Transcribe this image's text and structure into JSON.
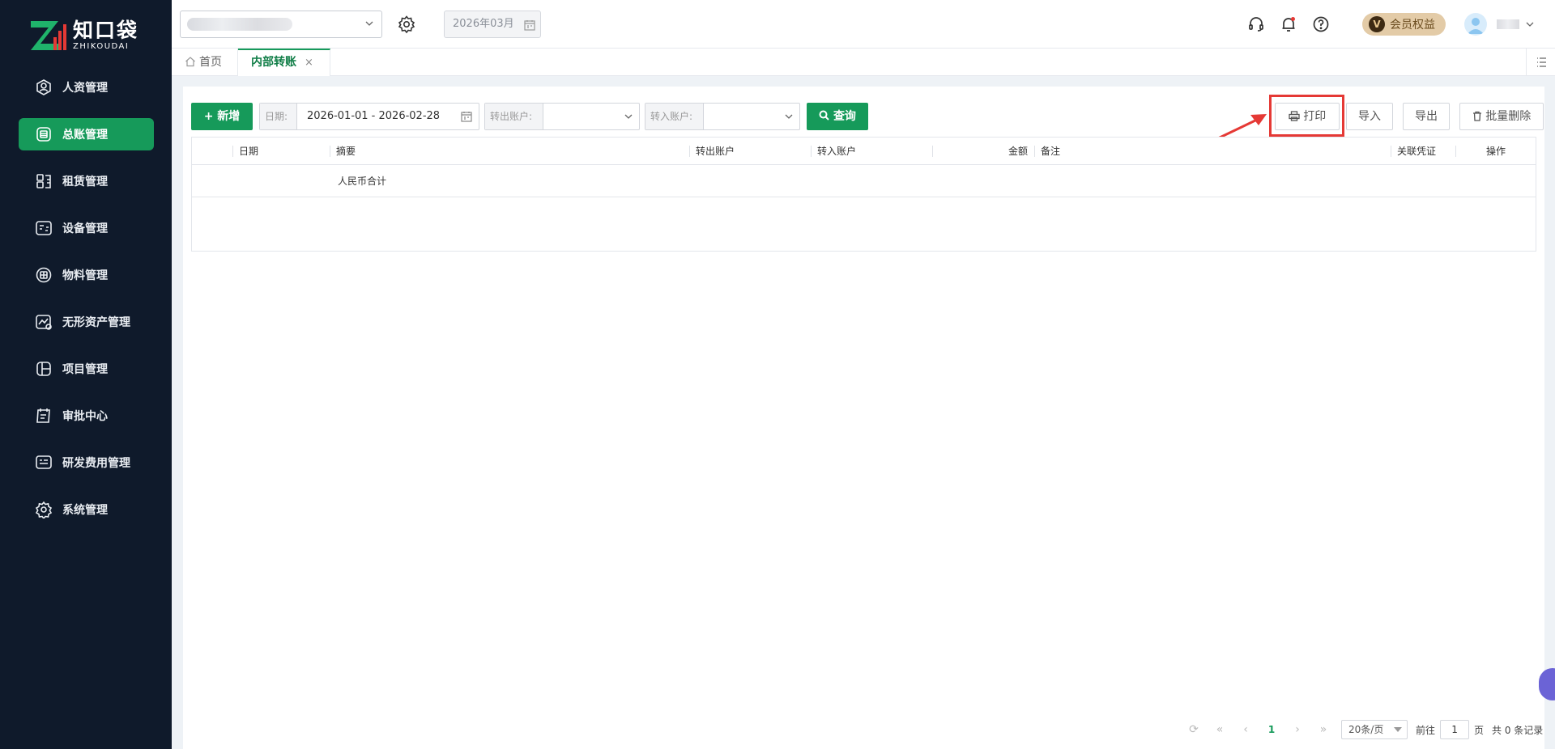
{
  "app": {
    "brand_cn": "知口袋",
    "brand_en": "ZHIKOUDAI",
    "brand_color": "#169a5a"
  },
  "sidebar": {
    "items": [
      {
        "label": "人资管理",
        "icon": "person-icon",
        "active": false
      },
      {
        "label": "总账管理",
        "icon": "ledger-icon",
        "active": true
      },
      {
        "label": "租赁管理",
        "icon": "lease-icon",
        "active": false
      },
      {
        "label": "设备管理",
        "icon": "device-icon",
        "active": false
      },
      {
        "label": "物料管理",
        "icon": "material-icon",
        "active": false
      },
      {
        "label": "无形资产管理",
        "icon": "intangible-asset-icon",
        "active": false
      },
      {
        "label": "项目管理",
        "icon": "project-icon",
        "active": false
      },
      {
        "label": "审批中心",
        "icon": "approval-icon",
        "active": false
      },
      {
        "label": "研发费用管理",
        "icon": "rd-expense-icon",
        "active": false
      },
      {
        "label": "系统管理",
        "icon": "settings-icon",
        "active": false
      }
    ]
  },
  "header": {
    "period": "2026年03月",
    "member_badge": "V",
    "member_label": "会员权益"
  },
  "tabs": {
    "home": "首页",
    "current": "内部转账",
    "close": "×"
  },
  "toolbar": {
    "add_label": "新增",
    "add_icon": "+",
    "date_label": "日期:",
    "date_value": "2026-01-01 - 2026-02-28",
    "from_label": "转出账户:",
    "to_label": "转入账户:",
    "query_label": "查询",
    "print_label": "打印",
    "import_label": "导入",
    "export_label": "导出",
    "batch_delete_label": "批量删除"
  },
  "table": {
    "columns": [
      "日期",
      "摘要",
      "转出账户",
      "转入账户",
      "金额",
      "备注",
      "关联凭证",
      "操作"
    ],
    "total_row": "人民币合计"
  },
  "pagination": {
    "current_page": "1",
    "page_size": "20条/页",
    "goto_label": "前往",
    "goto_value": "1",
    "page_unit": "页",
    "total_label": "共 0 条记录"
  }
}
